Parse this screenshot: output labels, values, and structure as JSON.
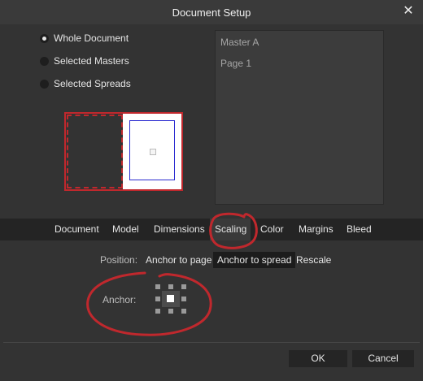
{
  "window": {
    "title": "Document Setup",
    "close_glyph": "✕",
    "close_icon": "close-icon"
  },
  "scope_options": [
    {
      "label": "Whole Document",
      "checked": true
    },
    {
      "label": "Selected Masters",
      "checked": false
    },
    {
      "label": "Selected Spreads",
      "checked": false
    }
  ],
  "masters_list": [
    "Master A",
    "Page 1"
  ],
  "tabs": [
    "Document",
    "Model",
    "Dimensions",
    "Scaling",
    "Color",
    "Margins",
    "Bleed"
  ],
  "active_tab": "Scaling",
  "scaling": {
    "position_label": "Position:",
    "position_options": [
      "Anchor to page",
      "Anchor to spread",
      "Rescale"
    ],
    "position_selected": "Anchor to spread",
    "anchor_label": "Anchor:",
    "anchor_selected": "center"
  },
  "buttons": {
    "ok": "OK",
    "cancel": "Cancel"
  },
  "colors": {
    "annotation": "#c0282d",
    "background": "#333333",
    "tabbar": "#242424"
  }
}
